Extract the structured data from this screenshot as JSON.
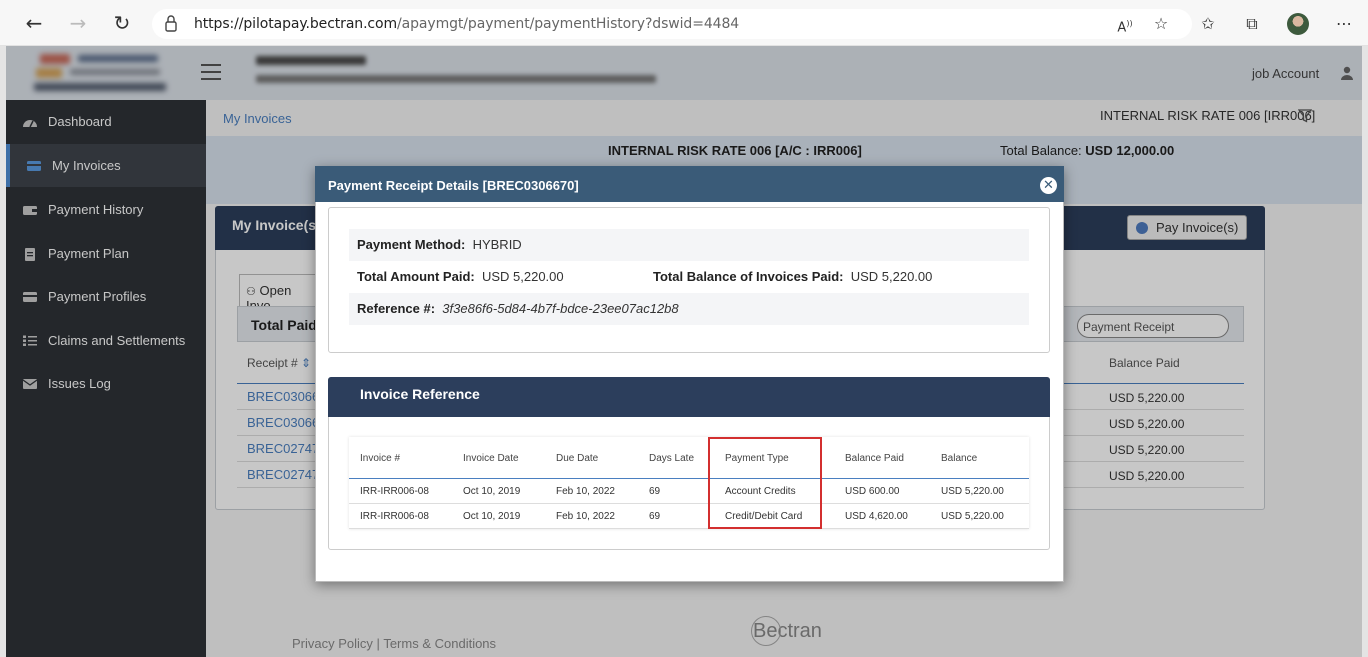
{
  "browser": {
    "url_host": "https://pilotapay.bectran.com",
    "url_path": "/apaymgt/payment/paymentHistory?dswid=4484"
  },
  "header": {
    "account_label": "job Account"
  },
  "sidebar": {
    "items": [
      {
        "label": "Dashboard",
        "icon": "dashboard-icon"
      },
      {
        "label": "My Invoices",
        "icon": "card-icon",
        "active": true
      },
      {
        "label": "Payment History",
        "icon": "wallet-icon"
      },
      {
        "label": "Payment Plan",
        "icon": "clipboard-icon"
      },
      {
        "label": "Payment Profiles",
        "icon": "credit-card-icon"
      },
      {
        "label": "Claims and Settlements",
        "icon": "checklist-icon"
      },
      {
        "label": "Issues Log",
        "icon": "envelope-icon"
      }
    ]
  },
  "page": {
    "breadcrumb": "My Invoices",
    "risk_selector": "INTERNAL RISK RATE 006 [IRR006]",
    "account_name": "INTERNAL RISK RATE 006 [A/C : IRR006]",
    "total_balance_label": "Total Balance:",
    "total_balance_value": "USD 12,000.00",
    "card_title": "My Invoice(s)",
    "pay_button": "Pay Invoice(s)",
    "open_tab": "Open Invo",
    "total_paid": "Total Paid",
    "search_placeholder": "Payment Receipt",
    "col_receipt": "Receipt #",
    "col_balance_paid": "Balance Paid",
    "rows": [
      {
        "receipt": "BREC03066",
        "balance_paid": "USD 5,220.00"
      },
      {
        "receipt": "BREC03066",
        "balance_paid": "USD 5,220.00"
      },
      {
        "receipt": "BREC02747",
        "balance_paid": "USD 5,220.00"
      },
      {
        "receipt": "BREC02747",
        "balance_paid": "USD 5,220.00"
      }
    ]
  },
  "footer": {
    "privacy": "Privacy Policy",
    "separator": "|",
    "terms": "Terms & Conditions",
    "logo": "Bectran"
  },
  "modal": {
    "title": "Payment Receipt Details [BREC0306670]",
    "payment_method_label": "Payment Method:",
    "payment_method_value": "HYBRID",
    "total_amount_label": "Total Amount Paid:",
    "total_amount_value": "USD 5,220.00",
    "total_balance_label": "Total Balance of Invoices Paid:",
    "total_balance_value": "USD 5,220.00",
    "reference_label": "Reference #:",
    "reference_value": "3f3e86f6-5d84-4b7f-bdce-23ee07ac12b8",
    "invoice_ref_title": "Invoice Reference",
    "columns": [
      "Invoice #",
      "Invoice Date",
      "Due Date",
      "Days Late",
      "Payment Type",
      "Balance Paid",
      "Balance"
    ],
    "rows": [
      {
        "invoice": "IRR-IRR006-08",
        "invoice_date": "Oct 10, 2019",
        "due_date": "Feb 10, 2022",
        "days_late": "69",
        "payment_type": "Account Credits",
        "balance_paid": "USD 600.00",
        "balance": "USD 5,220.00"
      },
      {
        "invoice": "IRR-IRR006-08",
        "invoice_date": "Oct 10, 2019",
        "due_date": "Feb 10, 2022",
        "days_late": "69",
        "payment_type": "Credit/Debit Card",
        "balance_paid": "USD 4,620.00",
        "balance": "USD 5,220.00"
      }
    ]
  },
  "colors": {
    "sidebar_bg": "#2f3338",
    "header_navy": "#2c3e5c",
    "modal_header": "#3a5b78",
    "link_blue": "#4a7fc0",
    "highlight_red": "#d32f2f"
  }
}
